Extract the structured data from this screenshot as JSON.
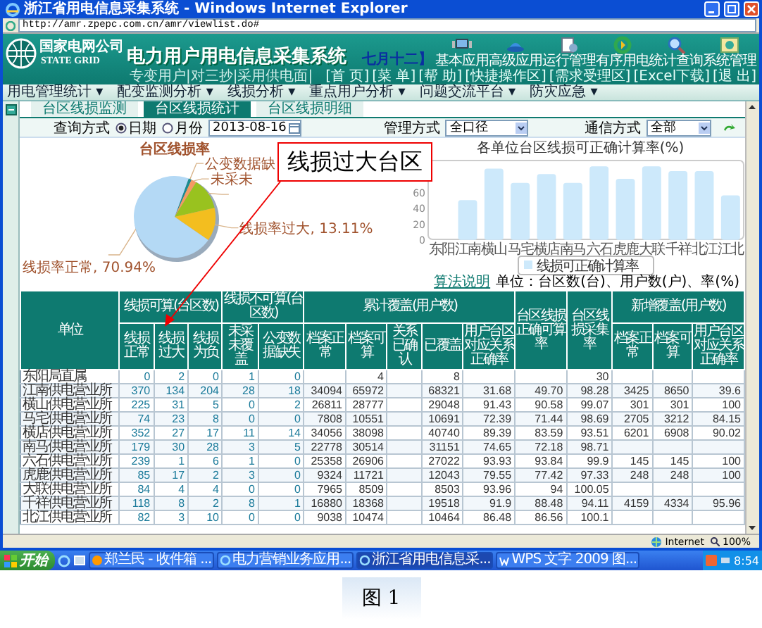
{
  "window": {
    "title": "浙江省用电信息采集系统 - Windows Internet Explorer",
    "address": "http://amr.zpepc.com.cn/amr/viewlist.do#"
  },
  "header": {
    "logo_cn": "国家电网公司",
    "logo_en": "STATE GRID",
    "system_title": "电力用户用电信息采集系统",
    "subtitle": "专变用户|对三抄|采用供电面|",
    "date_note": "七月十二】",
    "modules": [
      "基本应用",
      "高级应用",
      "运行管理",
      "有序用电",
      "统计查询",
      "系统管理"
    ],
    "links": [
      "[首 页]",
      "[菜 单]",
      "[帮 助]",
      "[快捷操作区]",
      "[需求受理区]",
      "[Excel下载]",
      "[退 出]"
    ]
  },
  "menu": [
    "用电管理统计 ▾",
    "配变监测分析 ▾",
    "线损分析 ▾",
    "重点用户分析 ▾",
    "问题交流平台 ▾",
    "防灾应急 ▾"
  ],
  "tabs": [
    {
      "label": "台区线损监测",
      "selected": false
    },
    {
      "label": "台区线损统计",
      "selected": true
    },
    {
      "label": "台区线损明细",
      "selected": false
    }
  ],
  "filters": {
    "query_label": "查询方式",
    "modes": [
      {
        "label": "日期",
        "selected": true
      },
      {
        "label": "月份",
        "selected": false
      }
    ],
    "date": "2013-08-16",
    "management_label": "管理方式",
    "management": "全口径",
    "comm_label": "通信方式",
    "comm": "全部"
  },
  "pie": {
    "chart_data": {
      "type": "pie",
      "title": "台区线损率",
      "categories": [
        "公变数据缺",
        "未采未",
        null,
        "线损率过大, 13.11%",
        "线损率正常, 70.94%"
      ],
      "values": [
        1.23,
        2.08,
        12.64,
        13.11,
        70.94
      ],
      "colors": [
        "#1b8a8e",
        "#f59a62",
        "#99c21f",
        "#f3be1f",
        "#b4d9f5"
      ]
    }
  },
  "bar": {
    "chart_data": {
      "type": "bar",
      "title": "各单位台区线损可正确计算率(%)",
      "categories": [
        "东阳",
        "江南",
        "横山",
        "马宅",
        "横店",
        "南马",
        "六石",
        "虎鹿",
        "大联",
        "千祥",
        "北江",
        "江北"
      ],
      "series": [
        {
          "name": "线损可正确计算率",
          "color": "#cde9fb",
          "values": [
            0,
            49,
            89,
            71,
            82,
            71,
            92,
            76,
            92,
            86,
            86,
            55
          ]
        }
      ],
      "ylim": [
        0,
        100
      ],
      "yticks": [
        0,
        20,
        40,
        60
      ]
    }
  },
  "table_note": {
    "link": "算法说明",
    "units": "单位：台区数(台)、用户数(户)、率(%)"
  },
  "table": {
    "unit_heading": "单位",
    "groups": [
      {
        "label": "线损可算(台区数)",
        "columns": [
          "线损正常",
          "线损过大",
          "线损为负"
        ]
      },
      {
        "label": "线损不可算(台区数)",
        "columns": [
          "未采未覆盖",
          "公变数据缺失"
        ]
      },
      {
        "label": "累计覆盖(用户数)",
        "columns": [
          "档案正常",
          "档案可算",
          "关系已确认",
          "已覆盖",
          "用户台区对应关系正确率"
        ]
      },
      {
        "label": "台区线损正确可算率"
      },
      {
        "label": "台区线损采集率"
      },
      {
        "label": "新增覆盖(用户数)",
        "columns": [
          "档案正常",
          "档案可算",
          "用户台区对应关系正确率"
        ]
      }
    ],
    "rows": [
      [
        "东阳局直属",
        "0",
        "2",
        "0",
        "1",
        "0",
        null,
        "4",
        null,
        "8",
        null,
        null,
        "30",
        null,
        null,
        null
      ],
      [
        "江南供电营业所",
        "370",
        "134",
        "204",
        "28",
        "18",
        "34094",
        "65972",
        null,
        "68321",
        "31.68",
        "49.70",
        "98.28",
        "3425",
        "8650",
        "39.6"
      ],
      [
        "横山供电营业所",
        "225",
        "31",
        "5",
        "0",
        "2",
        "26811",
        "28777",
        null,
        "29048",
        "91.43",
        "90.58",
        "99.07",
        "301",
        "301",
        "100"
      ],
      [
        "马宅供电营业所",
        "74",
        "23",
        "8",
        "0",
        "0",
        "7808",
        "10551",
        null,
        "10691",
        "72.39",
        "71.44",
        "98.69",
        "2705",
        "3212",
        "84.15"
      ],
      [
        "横店供电营业所",
        "352",
        "27",
        "17",
        "11",
        "14",
        "34056",
        "38098",
        null,
        "40740",
        "89.39",
        "83.59",
        "93.51",
        "6201",
        "6908",
        "90.02"
      ],
      [
        "南马供电营业所",
        "179",
        "30",
        "28",
        "3",
        "5",
        "22778",
        "30514",
        null,
        "31151",
        "74.65",
        "72.18",
        "98.71",
        null,
        null,
        null
      ],
      [
        "六石供电营业所",
        "239",
        "1",
        "6",
        "1",
        "0",
        "25358",
        "26906",
        null,
        "27022",
        "93.93",
        "93.84",
        "99.9",
        "145",
        "145",
        "100"
      ],
      [
        "虎鹿供电营业所",
        "85",
        "17",
        "2",
        "3",
        "0",
        "9324",
        "11721",
        null,
        "12043",
        "79.55",
        "77.42",
        "97.33",
        "248",
        "248",
        "100"
      ],
      [
        "大联供电营业所",
        "84",
        "4",
        "4",
        "0",
        "0",
        "7965",
        "8509",
        null,
        "8503",
        "93.96",
        "94",
        "100.05",
        null,
        null,
        null
      ],
      [
        "千祥供电营业所",
        "118",
        "8",
        "2",
        "8",
        "1",
        "16880",
        "18368",
        null,
        "19518",
        "91.9",
        "88.48",
        "94.11",
        "4159",
        "4334",
        "95.96"
      ],
      [
        "北江供电营业所",
        "82",
        "3",
        "10",
        "0",
        "0",
        "9038",
        "10474",
        null,
        "10464",
        "86.48",
        "86.56",
        "100.1",
        null,
        null,
        null
      ]
    ]
  },
  "callout": "线损过大台区",
  "status_bar": {
    "zone": "Internet",
    "zoom": "100%"
  },
  "taskbar": {
    "start": "开始",
    "tasks": [
      {
        "label": "郑兰民 - 收件箱 ...",
        "selected": false
      },
      {
        "label": "电力营销业务应用...",
        "selected": false
      },
      {
        "label": "浙江省用电信息采...",
        "selected": true
      },
      {
        "label": "WPS 文字 2009 图...",
        "selected": false
      }
    ],
    "clock": "8:54"
  },
  "caption": "图 1"
}
